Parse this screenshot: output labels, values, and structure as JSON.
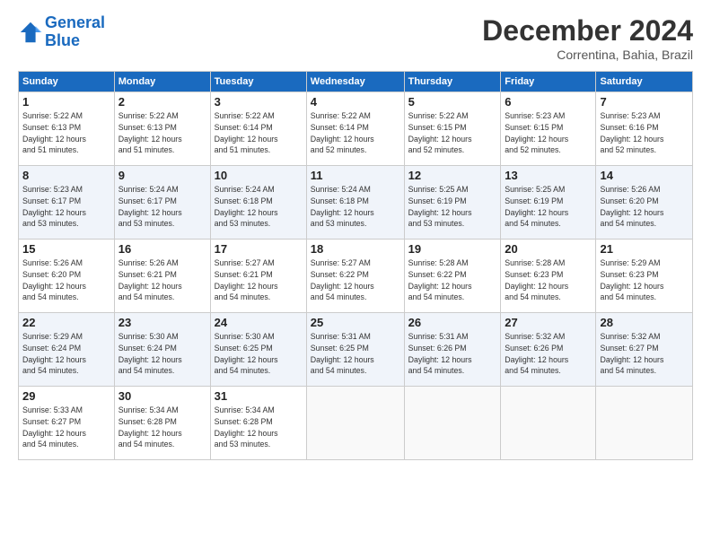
{
  "logo": {
    "line1": "General",
    "line2": "Blue"
  },
  "title": "December 2024",
  "subtitle": "Correntina, Bahia, Brazil",
  "days_of_week": [
    "Sunday",
    "Monday",
    "Tuesday",
    "Wednesday",
    "Thursday",
    "Friday",
    "Saturday"
  ],
  "weeks": [
    [
      {
        "day": "1",
        "info": "Sunrise: 5:22 AM\nSunset: 6:13 PM\nDaylight: 12 hours\nand 51 minutes."
      },
      {
        "day": "2",
        "info": "Sunrise: 5:22 AM\nSunset: 6:13 PM\nDaylight: 12 hours\nand 51 minutes."
      },
      {
        "day": "3",
        "info": "Sunrise: 5:22 AM\nSunset: 6:14 PM\nDaylight: 12 hours\nand 51 minutes."
      },
      {
        "day": "4",
        "info": "Sunrise: 5:22 AM\nSunset: 6:14 PM\nDaylight: 12 hours\nand 52 minutes."
      },
      {
        "day": "5",
        "info": "Sunrise: 5:22 AM\nSunset: 6:15 PM\nDaylight: 12 hours\nand 52 minutes."
      },
      {
        "day": "6",
        "info": "Sunrise: 5:23 AM\nSunset: 6:15 PM\nDaylight: 12 hours\nand 52 minutes."
      },
      {
        "day": "7",
        "info": "Sunrise: 5:23 AM\nSunset: 6:16 PM\nDaylight: 12 hours\nand 52 minutes."
      }
    ],
    [
      {
        "day": "8",
        "info": "Sunrise: 5:23 AM\nSunset: 6:17 PM\nDaylight: 12 hours\nand 53 minutes."
      },
      {
        "day": "9",
        "info": "Sunrise: 5:24 AM\nSunset: 6:17 PM\nDaylight: 12 hours\nand 53 minutes."
      },
      {
        "day": "10",
        "info": "Sunrise: 5:24 AM\nSunset: 6:18 PM\nDaylight: 12 hours\nand 53 minutes."
      },
      {
        "day": "11",
        "info": "Sunrise: 5:24 AM\nSunset: 6:18 PM\nDaylight: 12 hours\nand 53 minutes."
      },
      {
        "day": "12",
        "info": "Sunrise: 5:25 AM\nSunset: 6:19 PM\nDaylight: 12 hours\nand 53 minutes."
      },
      {
        "day": "13",
        "info": "Sunrise: 5:25 AM\nSunset: 6:19 PM\nDaylight: 12 hours\nand 54 minutes."
      },
      {
        "day": "14",
        "info": "Sunrise: 5:26 AM\nSunset: 6:20 PM\nDaylight: 12 hours\nand 54 minutes."
      }
    ],
    [
      {
        "day": "15",
        "info": "Sunrise: 5:26 AM\nSunset: 6:20 PM\nDaylight: 12 hours\nand 54 minutes."
      },
      {
        "day": "16",
        "info": "Sunrise: 5:26 AM\nSunset: 6:21 PM\nDaylight: 12 hours\nand 54 minutes."
      },
      {
        "day": "17",
        "info": "Sunrise: 5:27 AM\nSunset: 6:21 PM\nDaylight: 12 hours\nand 54 minutes."
      },
      {
        "day": "18",
        "info": "Sunrise: 5:27 AM\nSunset: 6:22 PM\nDaylight: 12 hours\nand 54 minutes."
      },
      {
        "day": "19",
        "info": "Sunrise: 5:28 AM\nSunset: 6:22 PM\nDaylight: 12 hours\nand 54 minutes."
      },
      {
        "day": "20",
        "info": "Sunrise: 5:28 AM\nSunset: 6:23 PM\nDaylight: 12 hours\nand 54 minutes."
      },
      {
        "day": "21",
        "info": "Sunrise: 5:29 AM\nSunset: 6:23 PM\nDaylight: 12 hours\nand 54 minutes."
      }
    ],
    [
      {
        "day": "22",
        "info": "Sunrise: 5:29 AM\nSunset: 6:24 PM\nDaylight: 12 hours\nand 54 minutes."
      },
      {
        "day": "23",
        "info": "Sunrise: 5:30 AM\nSunset: 6:24 PM\nDaylight: 12 hours\nand 54 minutes."
      },
      {
        "day": "24",
        "info": "Sunrise: 5:30 AM\nSunset: 6:25 PM\nDaylight: 12 hours\nand 54 minutes."
      },
      {
        "day": "25",
        "info": "Sunrise: 5:31 AM\nSunset: 6:25 PM\nDaylight: 12 hours\nand 54 minutes."
      },
      {
        "day": "26",
        "info": "Sunrise: 5:31 AM\nSunset: 6:26 PM\nDaylight: 12 hours\nand 54 minutes."
      },
      {
        "day": "27",
        "info": "Sunrise: 5:32 AM\nSunset: 6:26 PM\nDaylight: 12 hours\nand 54 minutes."
      },
      {
        "day": "28",
        "info": "Sunrise: 5:32 AM\nSunset: 6:27 PM\nDaylight: 12 hours\nand 54 minutes."
      }
    ],
    [
      {
        "day": "29",
        "info": "Sunrise: 5:33 AM\nSunset: 6:27 PM\nDaylight: 12 hours\nand 54 minutes."
      },
      {
        "day": "30",
        "info": "Sunrise: 5:34 AM\nSunset: 6:28 PM\nDaylight: 12 hours\nand 54 minutes."
      },
      {
        "day": "31",
        "info": "Sunrise: 5:34 AM\nSunset: 6:28 PM\nDaylight: 12 hours\nand 53 minutes."
      },
      null,
      null,
      null,
      null
    ]
  ]
}
